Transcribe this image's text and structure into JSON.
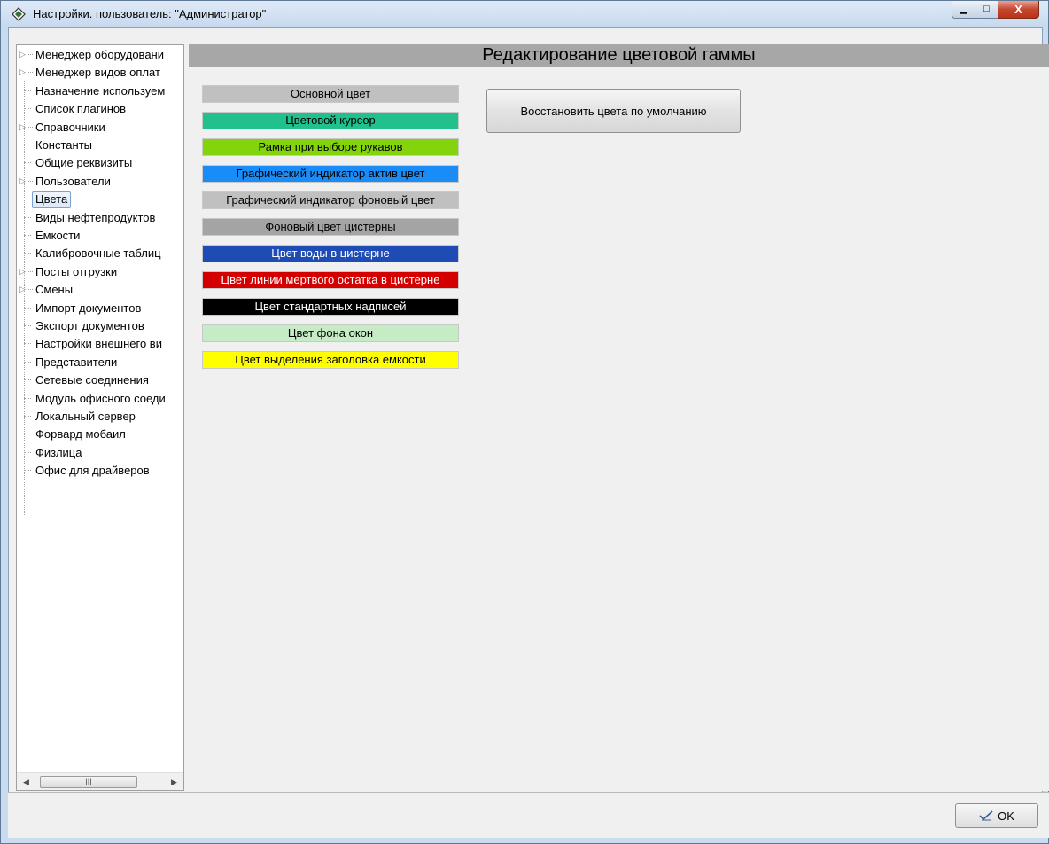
{
  "window": {
    "title": "Настройки. пользователь: \"Администратор\"",
    "minimize_glyph": "▁",
    "maximize_glyph": "□",
    "close_glyph": "X"
  },
  "tree": {
    "items": [
      {
        "label": "Менеджер оборудовани",
        "expandable": true
      },
      {
        "label": "Менеджер видов оплат",
        "expandable": true
      },
      {
        "label": "Назначение используем",
        "expandable": false
      },
      {
        "label": "Список плагинов",
        "expandable": false
      },
      {
        "label": "Справочники",
        "expandable": true
      },
      {
        "label": "Константы",
        "expandable": false
      },
      {
        "label": "Общие реквизиты",
        "expandable": false
      },
      {
        "label": "Пользователи",
        "expandable": true
      },
      {
        "label": "Цвета",
        "expandable": false,
        "selected": true
      },
      {
        "label": "Виды нефтепродуктов",
        "expandable": false
      },
      {
        "label": "Емкости",
        "expandable": false
      },
      {
        "label": "Калибровочные таблиц",
        "expandable": false
      },
      {
        "label": "Посты отгрузки",
        "expandable": true
      },
      {
        "label": "Смены",
        "expandable": true
      },
      {
        "label": "Импорт документов",
        "expandable": false
      },
      {
        "label": "Экспорт документов",
        "expandable": false
      },
      {
        "label": "Настройки внешнего ви",
        "expandable": false
      },
      {
        "label": "Представители",
        "expandable": false
      },
      {
        "label": "Сетевые соединения",
        "expandable": false
      },
      {
        "label": "Модуль офисного соеди",
        "expandable": false
      },
      {
        "label": "Локальный сервер",
        "expandable": false
      },
      {
        "label": "Форвард мобаил",
        "expandable": false
      },
      {
        "label": "Физлица",
        "expandable": false
      },
      {
        "label": "Офис для драйверов",
        "expandable": false
      }
    ],
    "scroll_left": "◀",
    "scroll_right": "▶",
    "scroll_thumb": "III"
  },
  "main": {
    "header": "Редактирование цветовой гаммы",
    "restore_button": "Восстановить цвета по умолчанию",
    "colors": [
      {
        "label": "Основной цвет",
        "bg": "#c0c0c0",
        "fg": "#000000"
      },
      {
        "label": "Цветовой курсор",
        "bg": "#22c08c",
        "fg": "#000000"
      },
      {
        "label": "Рамка при выборе рукавов",
        "bg": "#84d40c",
        "fg": "#000000"
      },
      {
        "label": "Графический индикатор актив цвет",
        "bg": "#1a8cf7",
        "fg": "#000000"
      },
      {
        "label": "Графический индикатор фоновый цвет",
        "bg": "#c0c0c0",
        "fg": "#000000"
      },
      {
        "label": "Фоновый цвет цистерны",
        "bg": "#a4a4a4",
        "fg": "#000000"
      },
      {
        "label": "Цвет воды в цистерне",
        "bg": "#1e4bb4",
        "fg": "#ffffff"
      },
      {
        "label": "Цвет линии мертвого остатка в цистерне",
        "bg": "#d40000",
        "fg": "#ffffff"
      },
      {
        "label": "Цвет стандартных надписей",
        "bg": "#000000",
        "fg": "#ffffff"
      },
      {
        "label": "Цвет фона окон",
        "bg": "#c6ecc6",
        "fg": "#000000"
      },
      {
        "label": "Цвет выделения заголовка емкости",
        "bg": "#ffff00",
        "fg": "#000000"
      }
    ]
  },
  "footer": {
    "ok_label": "OK"
  }
}
